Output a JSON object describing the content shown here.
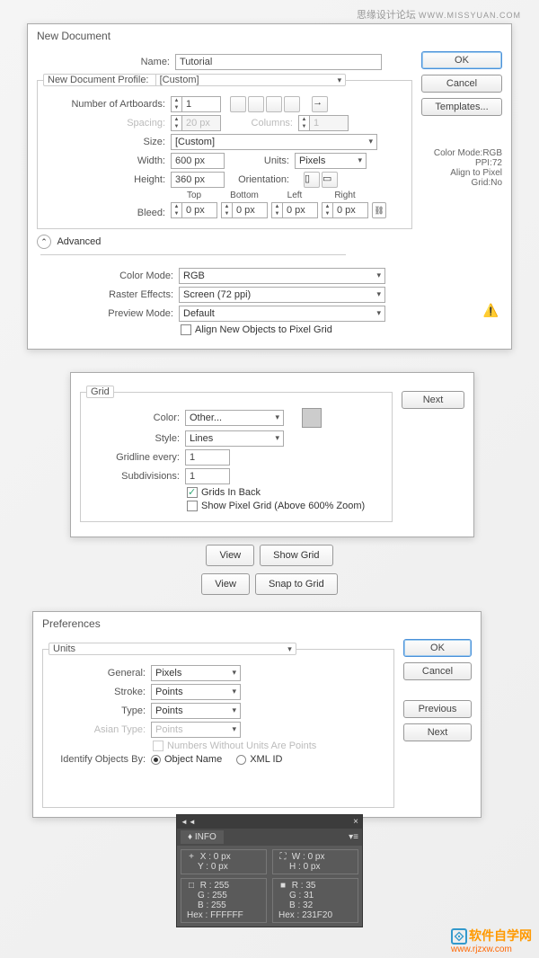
{
  "watermarks": {
    "top_cn": "思缘设计论坛",
    "top_url": "WWW.MISSYUAN.COM",
    "bottom_cn": "软件自学网",
    "bottom_url": "www.rjzxw.com"
  },
  "new_doc": {
    "title": "New Document",
    "name_label": "Name:",
    "name_value": "Tutorial",
    "profile_legend": "New Document Profile:",
    "profile_value": "[Custom]",
    "artboards_label": "Number of Artboards:",
    "artboards_value": "1",
    "spacing_label": "Spacing:",
    "spacing_value": "20 px",
    "columns_label": "Columns:",
    "columns_value": "1",
    "size_label": "Size:",
    "size_value": "[Custom]",
    "width_label": "Width:",
    "width_value": "600 px",
    "units_label": "Units:",
    "units_value": "Pixels",
    "height_label": "Height:",
    "height_value": "360 px",
    "orientation_label": "Orientation:",
    "bleed_label": "Bleed:",
    "bleed": {
      "top": "Top",
      "top_v": "0 px",
      "bottom": "Bottom",
      "bottom_v": "0 px",
      "left": "Left",
      "left_v": "0 px",
      "right": "Right",
      "right_v": "0 px"
    },
    "advanced": "Advanced",
    "color_mode_label": "Color Mode:",
    "color_mode_value": "RGB",
    "raster_label": "Raster Effects:",
    "raster_value": "Screen (72 ppi)",
    "preview_label": "Preview Mode:",
    "preview_value": "Default",
    "align_new": "Align New Objects to Pixel Grid",
    "info_color": "Color Mode:RGB",
    "info_ppi": "PPI:72",
    "info_align": "Align to Pixel Grid:No",
    "buttons": {
      "ok": "OK",
      "cancel": "Cancel",
      "templates": "Templates..."
    }
  },
  "grid": {
    "legend": "Grid",
    "color_label": "Color:",
    "color_value": "Other...",
    "style_label": "Style:",
    "style_value": "Lines",
    "gridline_label": "Gridline every:",
    "gridline_value": "1",
    "subdiv_label": "Subdivisions:",
    "subdiv_value": "1",
    "grids_in_back": "Grids In Back",
    "show_pixel": "Show Pixel Grid (Above 600% Zoom)",
    "next": "Next"
  },
  "menu": {
    "view": "View",
    "show_grid": "Show Grid",
    "snap_grid": "Snap to Grid"
  },
  "prefs": {
    "title": "Preferences",
    "section": "Units",
    "general_label": "General:",
    "general_value": "Pixels",
    "stroke_label": "Stroke:",
    "stroke_value": "Points",
    "type_label": "Type:",
    "type_value": "Points",
    "asian_label": "Asian Type:",
    "asian_value": "Points",
    "numbers_without": "Numbers Without Units Are Points",
    "identify_label": "Identify Objects By:",
    "obj_name": "Object Name",
    "xml_id": "XML ID",
    "buttons": {
      "ok": "OK",
      "cancel": "Cancel",
      "previous": "Previous",
      "next": "Next"
    }
  },
  "info_panel": {
    "title": "INFO",
    "x": "X :",
    "x_v": "0 px",
    "y": "Y :",
    "y_v": "0 px",
    "w": "W :",
    "w_v": "0 px",
    "h": "H :",
    "h_v": "0 px",
    "r1": "R :",
    "r1_v": "255",
    "g1": "G :",
    "g1_v": "255",
    "b1": "B :",
    "b1_v": "255",
    "hex1": "Hex :",
    "hex1_v": "FFFFFF",
    "r2": "R :",
    "r2_v": "35",
    "g2": "G :",
    "g2_v": "31",
    "b2": "B :",
    "b2_v": "32",
    "hex2": "Hex :",
    "hex2_v": "231F20"
  }
}
